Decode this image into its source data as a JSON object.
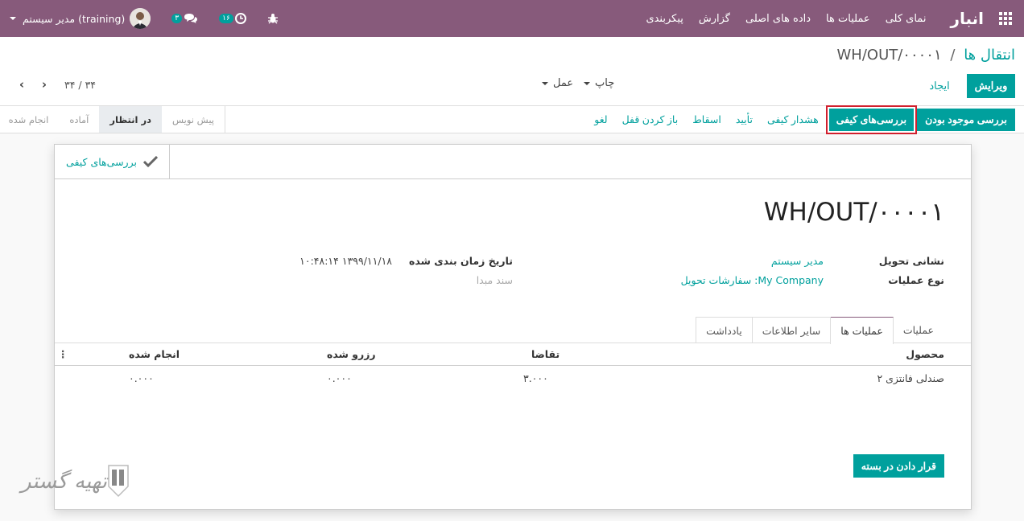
{
  "navbar": {
    "brand": "انبار",
    "menu": [
      "نمای کلی",
      "عملیات ها",
      "داده های اصلی",
      "گزارش",
      "پیکربندی"
    ],
    "user_name": "مدیر سیستم (training)",
    "messages_count": "۳",
    "activities_count": "۱۶"
  },
  "control": {
    "breadcrumb_parent": "انتقال ها",
    "breadcrumb_sep": "/",
    "breadcrumb_current": "WH/OUT/۰۰۰۰۱",
    "edit_label": "ویرایش",
    "create_label": "ایجاد",
    "print_label": "چاپ",
    "action_label": "عمل",
    "pager_value": "۳۴ / ۳۴"
  },
  "statusbar": {
    "buttons": [
      "بررسی موجود بودن",
      "بررسی‌های کیفی",
      "هشدار کیفی",
      "تأیید",
      "اسقاط",
      "باز کردن قفل",
      "لغو"
    ],
    "stages": [
      "پیش نویس",
      "در انتظار",
      "آماده",
      "انجام شده"
    ],
    "active_stage": "در انتظار"
  },
  "sheet": {
    "smart_button": "بررسی‌های کیفی",
    "title": "WH/OUT/۰۰۰۰۱",
    "fields": {
      "delivery_address_label": "نشانی تحویل",
      "delivery_address_value": "مدیر سیستم",
      "operation_type_label": "نوع عملیات",
      "operation_type_value": "My Company: سفارشات تحویل",
      "scheduled_date_label": "تاریخ زمان بندی شده",
      "scheduled_date_value": "۱۳۹۹/۱۱/۱۸ ۱۰:۴۸:۱۴",
      "source_document_placeholder": "سند مبدا"
    },
    "tabs": [
      "عملیات",
      "عملیات ها",
      "سایر اطلاعات",
      "یادداشت"
    ],
    "active_tab": "عملیات ها",
    "table": {
      "headers": [
        "محصول",
        "تقاضا",
        "رزرو شده",
        "انجام شده"
      ],
      "rows": [
        {
          "product": "صندلی فانتزی ۲",
          "demand": "۳.۰۰۰",
          "reserved": "۰.۰۰۰",
          "done": "۰.۰۰۰"
        }
      ]
    },
    "put_in_pack": "قرار دادن در بسته"
  },
  "watermark": {
    "text": "تهیه گستر"
  },
  "colors": {
    "brand": "#875a7b",
    "accent": "#00a09d",
    "highlight": "#d1202e"
  }
}
